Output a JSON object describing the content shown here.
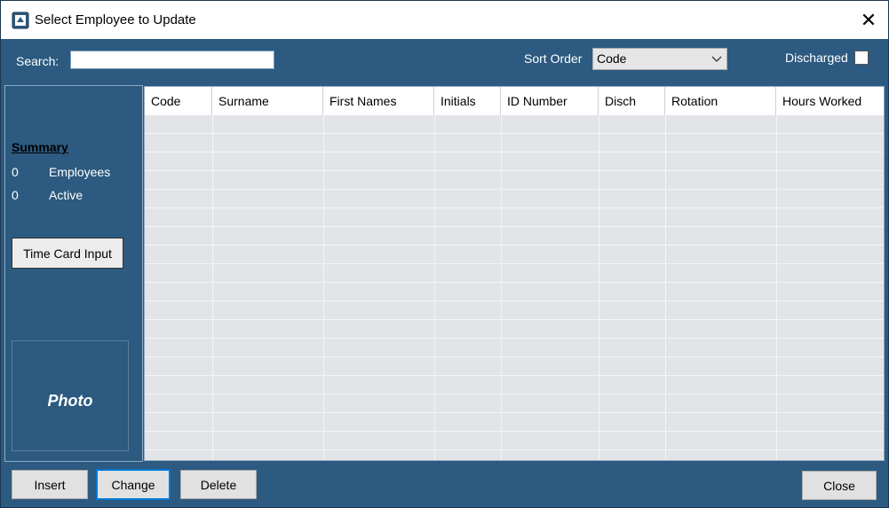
{
  "window": {
    "title": "Select Employee to Update",
    "close_glyph": "✕"
  },
  "toolbar": {
    "search_label": "Search:",
    "search_value": "",
    "sort_label": "Sort Order",
    "sort_value": "Code",
    "discharged_label": "Discharged",
    "discharged_checked": false
  },
  "sidebar": {
    "summary_title": "Summary",
    "rows": [
      {
        "count": "0",
        "label": "Employees"
      },
      {
        "count": "0",
        "label": "Active"
      }
    ],
    "time_card_button": "Time Card Input",
    "photo_label": "Photo"
  },
  "grid": {
    "columns": [
      "Code",
      "Surname",
      "First Names",
      "Initials",
      "ID Number",
      "Disch",
      "Rotation",
      "Hours Worked"
    ],
    "rows": []
  },
  "footer": {
    "insert_label": "Insert",
    "change_label": "Change",
    "delete_label": "Delete",
    "close_label": "Close"
  },
  "colors": {
    "panel_bg": "#2c5a80",
    "grid_bg": "#e2e4e7",
    "focus_border": "#0078d7"
  },
  "icons": {
    "app": "app-icon",
    "close": "close-icon",
    "dropdown": "chevron-down-icon"
  }
}
